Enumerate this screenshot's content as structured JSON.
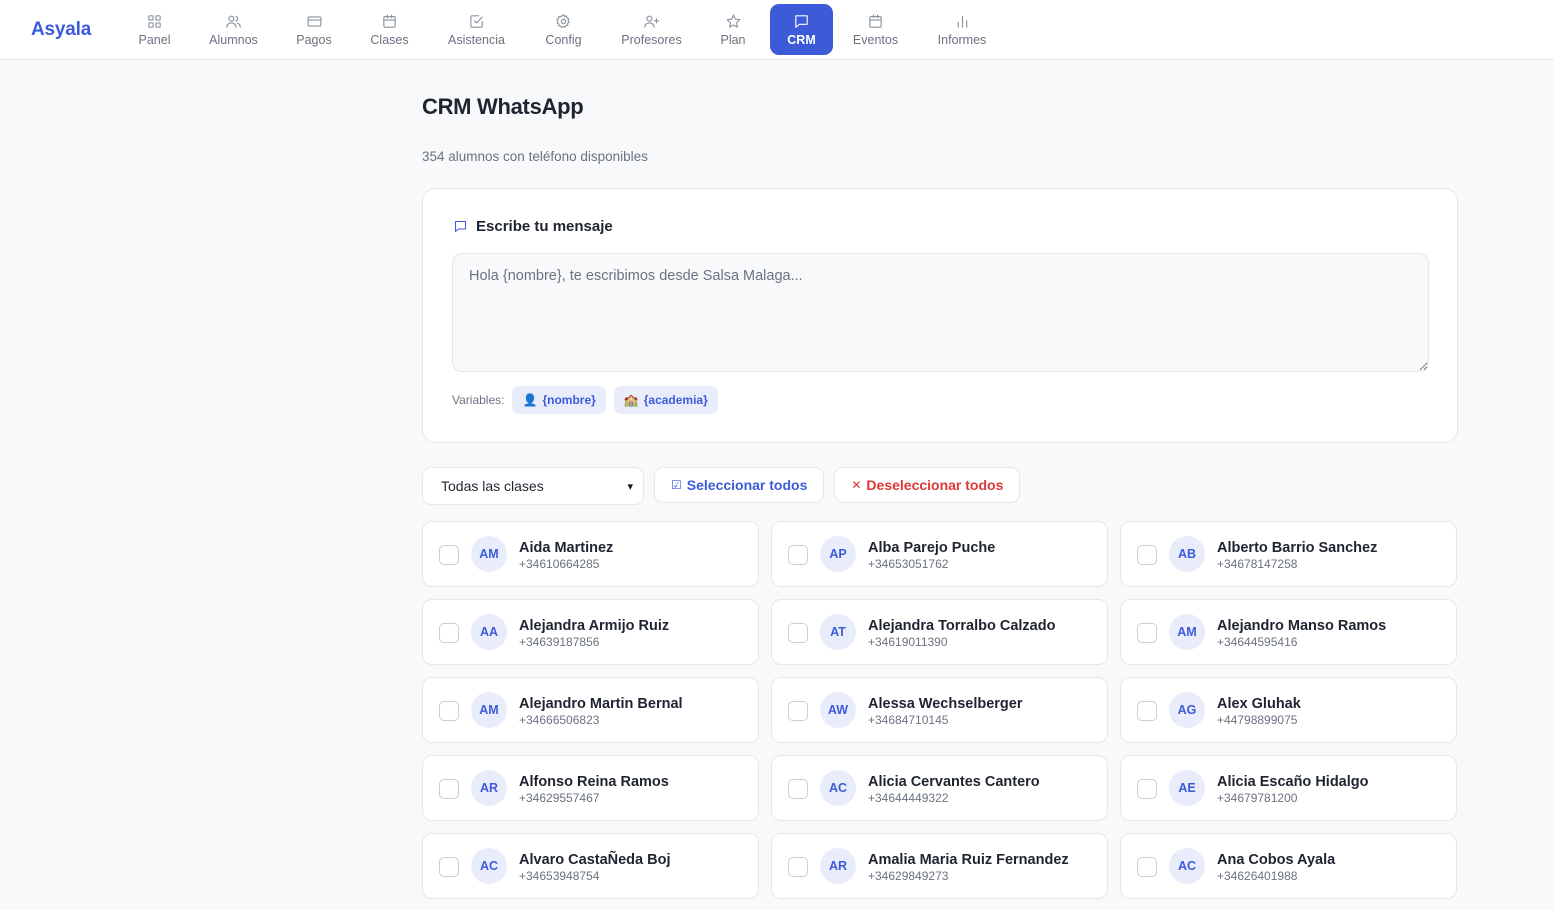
{
  "brand": "Asyala",
  "nav": [
    {
      "label": "Panel",
      "icon": "grid-icon"
    },
    {
      "label": "Alumnos",
      "icon": "users-icon"
    },
    {
      "label": "Pagos",
      "icon": "credit-card-icon"
    },
    {
      "label": "Clases",
      "icon": "calendar-icon"
    },
    {
      "label": "Asistencia",
      "icon": "check-square-icon"
    },
    {
      "label": "Config",
      "icon": "gear-icon"
    },
    {
      "label": "Profesores",
      "icon": "user-plus-icon"
    },
    {
      "label": "Plan",
      "icon": "star-icon"
    },
    {
      "label": "CRM",
      "icon": "message-icon",
      "active": true
    },
    {
      "label": "Eventos",
      "icon": "calendar-icon"
    },
    {
      "label": "Informes",
      "icon": "bar-chart-icon"
    }
  ],
  "page": {
    "title": "CRM WhatsApp",
    "subtitle": "354 alumnos con teléfono disponibles"
  },
  "composer": {
    "heading": "Escribe tu mensaje",
    "placeholder": "Hola {nombre}, te escribimos desde Salsa Malaga...",
    "variables_label": "Variables:",
    "variables": [
      {
        "icon": "👤",
        "label": "{nombre}"
      },
      {
        "icon": "🏫",
        "label": "{academia}"
      }
    ]
  },
  "filters": {
    "class_select": "Todas las clases",
    "select_all": "Seleccionar todos",
    "select_all_icon": "☑",
    "deselect_all": "Deseleccionar todos",
    "deselect_all_icon": "✕"
  },
  "students": [
    {
      "initials": "AM",
      "name": "Aida Martinez",
      "phone": "+34610664285"
    },
    {
      "initials": "AP",
      "name": "Alba Parejo Puche",
      "phone": "+34653051762"
    },
    {
      "initials": "AB",
      "name": "Alberto Barrio Sanchez",
      "phone": "+34678147258"
    },
    {
      "initials": "AA",
      "name": "Alejandra Armijo Ruiz",
      "phone": "+34639187856"
    },
    {
      "initials": "AT",
      "name": "Alejandra Torralbo Calzado",
      "phone": "+34619011390"
    },
    {
      "initials": "AM",
      "name": "Alejandro Manso Ramos",
      "phone": "+34644595416"
    },
    {
      "initials": "AM",
      "name": "Alejandro Martin Bernal",
      "phone": "+34666506823"
    },
    {
      "initials": "AW",
      "name": "Alessa Wechselberger",
      "phone": "+34684710145"
    },
    {
      "initials": "AG",
      "name": "Alex Gluhak",
      "phone": "+44798899075"
    },
    {
      "initials": "AR",
      "name": "Alfonso Reina Ramos",
      "phone": "+34629557467"
    },
    {
      "initials": "AC",
      "name": "Alicia Cervantes Cantero",
      "phone": "+34644449322"
    },
    {
      "initials": "AE",
      "name": "Alicia Escaño Hidalgo",
      "phone": "+34679781200"
    },
    {
      "initials": "AC",
      "name": "Alvaro CastaÑeda Boj",
      "phone": "+34653948754"
    },
    {
      "initials": "AR",
      "name": "Amalia Maria Ruiz Fernandez",
      "phone": "+34629849273"
    },
    {
      "initials": "AC",
      "name": "Ana Cobos Ayala",
      "phone": "+34626401988"
    }
  ]
}
